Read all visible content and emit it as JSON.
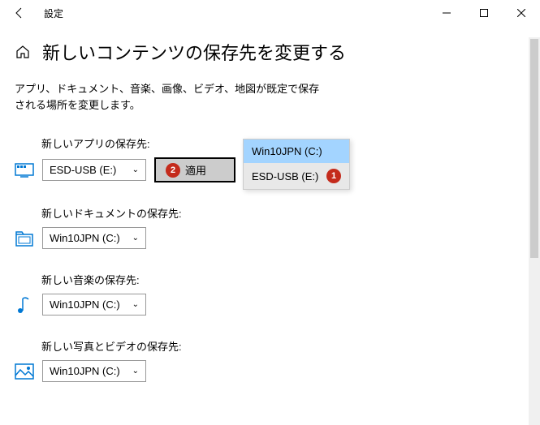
{
  "titlebar": {
    "title": "設定"
  },
  "header": {
    "title": "新しいコンテンツの保存先を変更する"
  },
  "desc": "アプリ、ドキュメント、音楽、画像、ビデオ、地図が既定で保存される場所を変更します。",
  "settings": {
    "apps": {
      "label": "新しいアプリの保存先:",
      "value": "ESD-USB (E:)"
    },
    "docs": {
      "label": "新しいドキュメントの保存先:",
      "value": "Win10JPN (C:)"
    },
    "music": {
      "label": "新しい音楽の保存先:",
      "value": "Win10JPN (C:)"
    },
    "photos": {
      "label": "新しい写真とビデオの保存先:",
      "value": "Win10JPN (C:)"
    }
  },
  "apply_label": "適用",
  "dropdown": {
    "opt1": "Win10JPN (C:)",
    "opt2": "ESD-USB (E:)"
  },
  "badges": {
    "b1": "1",
    "b2": "2"
  }
}
